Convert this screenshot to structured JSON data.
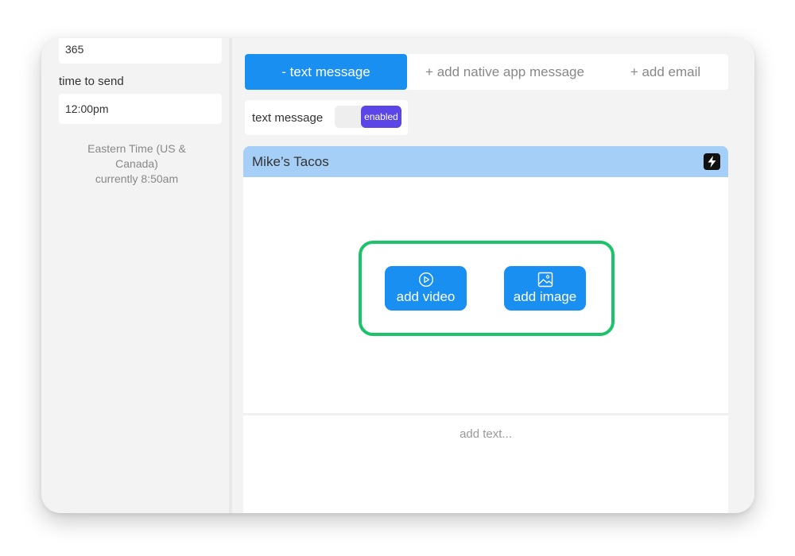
{
  "sidebar": {
    "days_value": "365",
    "time_label": "time to send",
    "time_value": "12:00pm",
    "timezone_line1": "Eastern Time (US &",
    "timezone_line2": "Canada)",
    "timezone_line3": "currently 8:50am"
  },
  "tabs": [
    {
      "label": "- text message",
      "active": true
    },
    {
      "label": "+ add native app message",
      "active": false
    },
    {
      "label": "+ add email",
      "active": false
    }
  ],
  "toggle": {
    "label": "text message",
    "state": "enabled"
  },
  "card": {
    "title": "Mike’s Tacos",
    "header_icon": "bolt-icon",
    "add_video_label": "add video",
    "add_image_label": "add image",
    "text_placeholder": "add text..."
  },
  "colors": {
    "accent_blue": "#1a8ff2",
    "header_blue": "#a5cff6",
    "toggle_purple": "#5b45e6",
    "highlight_green": "#1bc46a"
  }
}
